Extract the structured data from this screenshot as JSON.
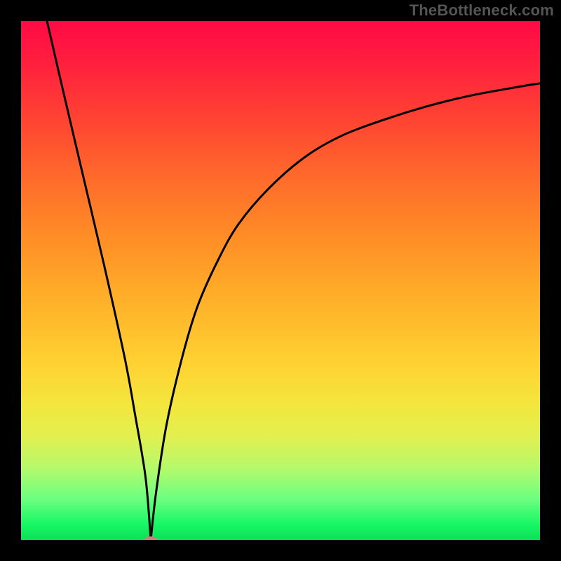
{
  "watermark": "TheBottleneck.com",
  "colors": {
    "curve": "#000000",
    "vertex_marker": "#d27b79",
    "gradient_top": "#ff0a45",
    "gradient_bottom": "#0cdf56",
    "background": "#000000"
  },
  "chart_data": {
    "type": "line",
    "title": "",
    "xlabel": "",
    "ylabel": "",
    "xlim": [
      0,
      100
    ],
    "ylim": [
      0,
      100
    ],
    "grid": false,
    "legend": false,
    "series": [
      {
        "name": "left-branch",
        "x": [
          5,
          8,
          12,
          16,
          20,
          22,
          24,
          25
        ],
        "values": [
          100,
          87,
          70,
          53,
          35,
          24,
          12,
          0
        ]
      },
      {
        "name": "right-branch",
        "x": [
          25,
          26,
          28,
          31,
          34,
          38,
          42,
          48,
          55,
          62,
          70,
          78,
          86,
          94,
          100
        ],
        "values": [
          0,
          9,
          22,
          35,
          45,
          54,
          61,
          68,
          74,
          78,
          81,
          83.5,
          85.5,
          87,
          88
        ]
      }
    ],
    "vertex": {
      "x": 25,
      "y": 0
    },
    "annotations": []
  }
}
